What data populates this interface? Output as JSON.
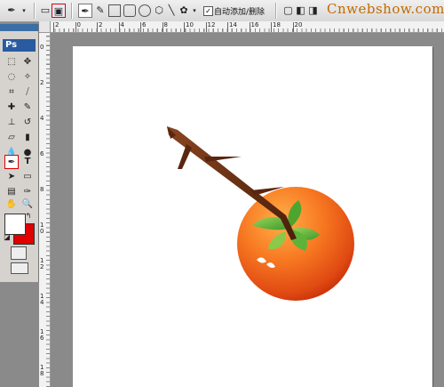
{
  "options_bar": {
    "pen_tool_icon": "pen-icon",
    "autoadd_checked": "✓",
    "autoadd_label": "自动添加/删除",
    "watermark": "Cnwebshow.com"
  },
  "toolbox": {
    "logo": "Ps",
    "type_tool_glyph": "T",
    "foreground_color": "#ffffff",
    "background_color": "#e00000"
  },
  "ruler_top": {
    "labels": [
      "2",
      "0",
      "2",
      "4",
      "6",
      "8",
      "10",
      "12",
      "14",
      "16",
      "18",
      "20"
    ]
  },
  "ruler_left": {
    "labels": [
      "0",
      "2",
      "4",
      "6",
      "8",
      "10",
      "12",
      "14",
      "16",
      "18"
    ]
  },
  "colors": {
    "canvas": "#ffffff",
    "persimmon_light": "#ff9a3a",
    "persimmon_dark": "#d8320a",
    "leaf": "#6ab83a",
    "branch": "#6b2e12",
    "selection_highlight": "#dd0000"
  }
}
